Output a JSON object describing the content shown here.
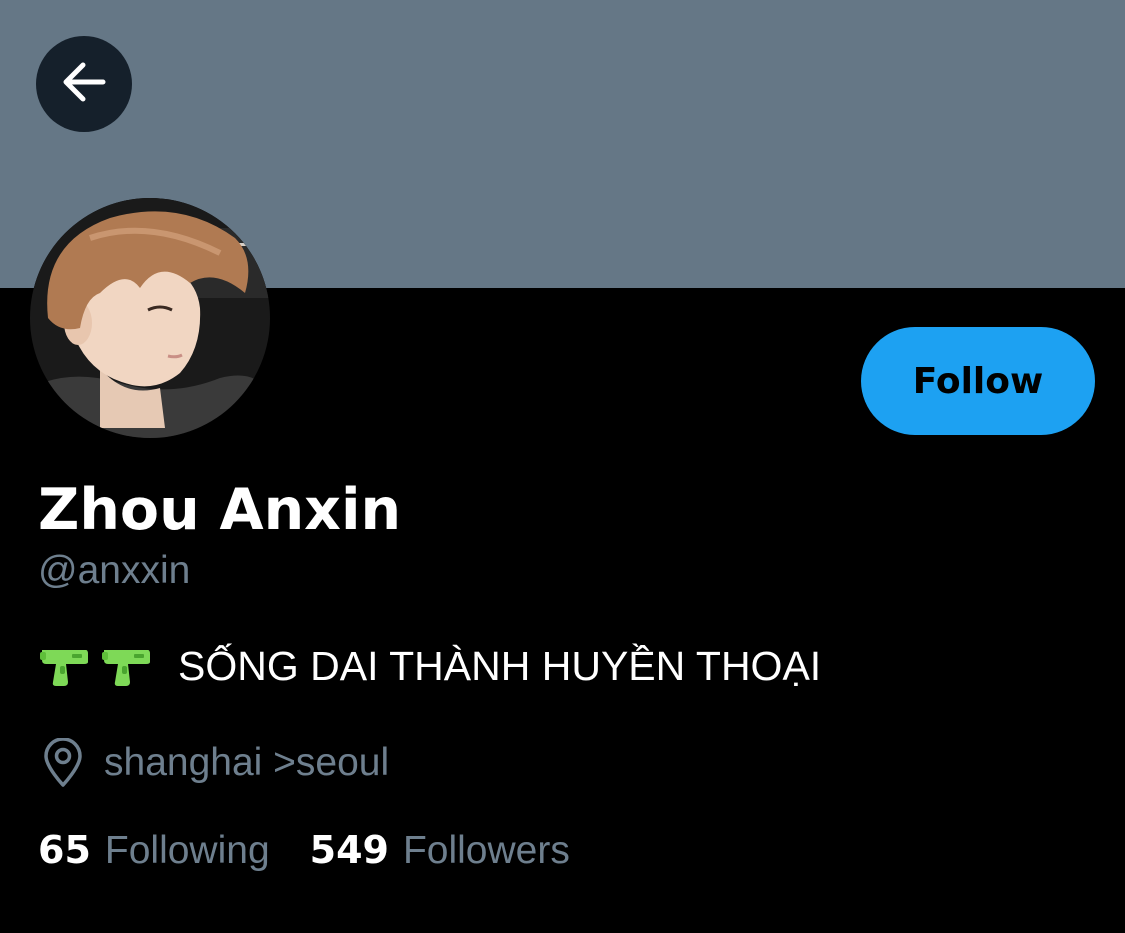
{
  "colors": {
    "banner": "#657786",
    "background": "#000000",
    "accent": "#1da1f2",
    "secondary_text": "#6e7f8e",
    "primary_text": "#ffffff",
    "back_button_bg": "#15202b"
  },
  "header": {
    "back_icon": "arrow-left-icon"
  },
  "profile": {
    "display_name": "Zhou Anxin",
    "handle": "@anxxin",
    "bio": {
      "emoji": [
        "water-pistol-icon",
        "water-pistol-icon"
      ],
      "text": "SỐNG DAI THÀNH HUYỀN THOẠI"
    },
    "location": {
      "icon": "location-pin-icon",
      "text": "shanghai >seoul"
    },
    "stats": {
      "following_count": "65",
      "following_label": "Following",
      "followers_count": "549",
      "followers_label": "Followers"
    }
  },
  "actions": {
    "follow_label": "Follow"
  }
}
